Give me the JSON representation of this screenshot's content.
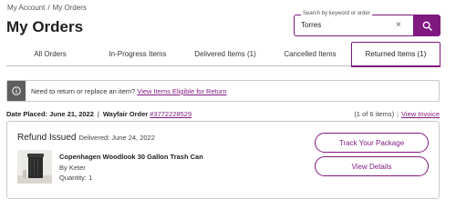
{
  "breadcrumb": {
    "account": "My Account",
    "separator": "/",
    "current": "My Orders"
  },
  "page_title": "My Orders",
  "search": {
    "label": "Search by keyword or order",
    "value": "Torres",
    "clear_icon": "×"
  },
  "tabs": [
    {
      "label": "All Orders",
      "active": false
    },
    {
      "label": "In-Progress Items",
      "active": false
    },
    {
      "label": "Delivered Items (1)",
      "active": false
    },
    {
      "label": "Cancelled Items",
      "active": false
    },
    {
      "label": "Returned Items (1)",
      "active": true
    }
  ],
  "notice": {
    "text": "Need to return or replace an item?",
    "link": "View Items Eligible for Return"
  },
  "order": {
    "date_placed": "Date Placed: June 21, 2022",
    "divider": "|",
    "order_prefix": "Wayfair Order ",
    "order_number": "#3772228529",
    "count": "(1 of 6 items)",
    "view_invoice": "View Invoice",
    "status": "Refund Issued",
    "delivered": "Delivered: June 24, 2022",
    "item": {
      "name": "Copenhagen Woodlook 30 Gallon Trash Can",
      "brand": "By Keter",
      "quantity": "Quantity: 1"
    },
    "actions": {
      "track": "Track Your Package",
      "details": "View Details"
    }
  },
  "colors": {
    "accent": "#7f187f",
    "notice_icon_bg": "#5e5e5e",
    "border": "#c9c9c9"
  },
  "icons": {
    "search_button": "search-icon",
    "notice": "info-icon",
    "clear": "close-icon"
  }
}
